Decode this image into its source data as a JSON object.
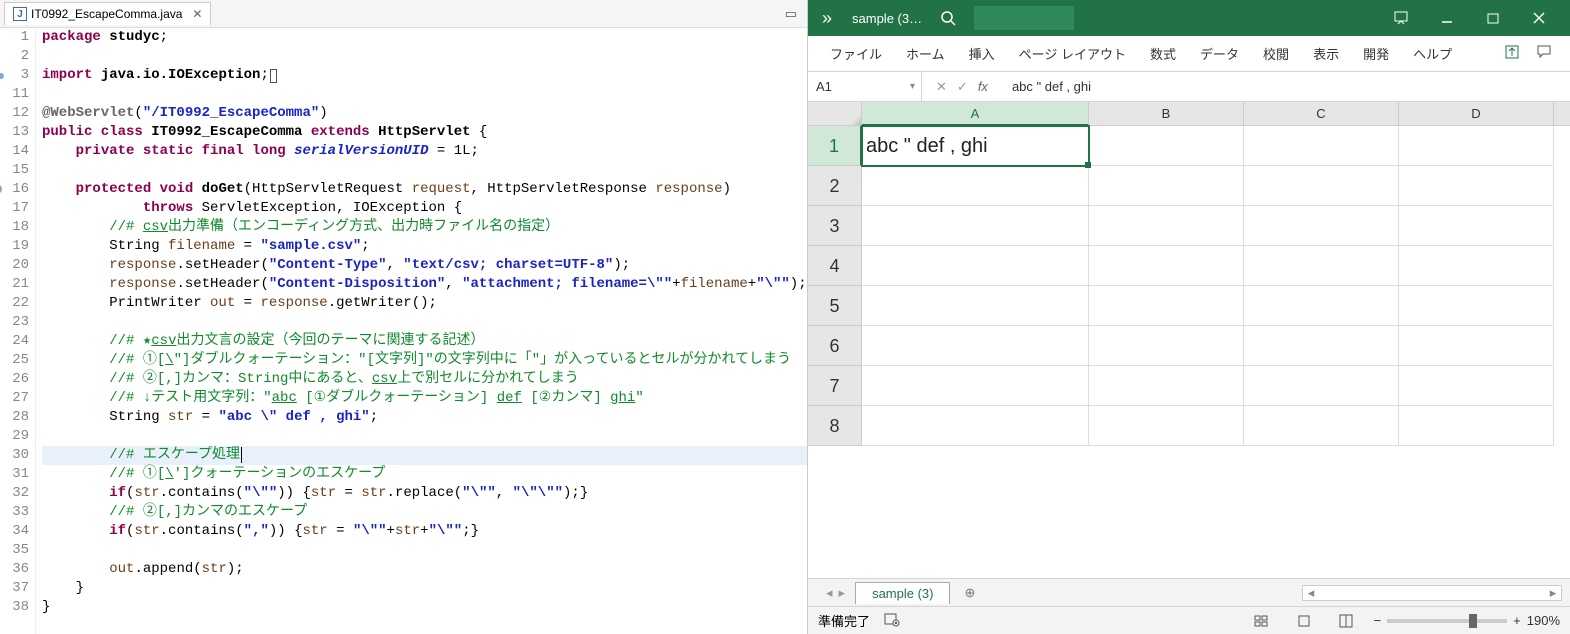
{
  "ide": {
    "tab_filename": "IT0992_EscapeComma.java",
    "tab_close": "✕",
    "lines": [
      {
        "n": "1",
        "html": "<span class='k'>package</span> <span class='t'>studyc</span>;"
      },
      {
        "n": "2",
        "html": ""
      },
      {
        "n": "3",
        "dot": true,
        "html": "<span class='k'>import</span> <span class='t'>java.io.IOException</span>;<span class='cursbox'></span>"
      },
      {
        "n": "11",
        "html": ""
      },
      {
        "n": "12",
        "html": "<span class='at'>@WebServlet</span>(<span class='s'>\"/IT0992_EscapeComma\"</span>)"
      },
      {
        "n": "13",
        "html": "<span class='k'>public class</span> <span class='t'>IT0992_EscapeComma</span> <span class='k'>extends</span> <span class='t'>HttpServlet</span> {"
      },
      {
        "n": "14",
        "html": "    <span class='k'>private static final long</span> <span class='fld'>serialVersionUID</span> = 1L;"
      },
      {
        "n": "15",
        "html": ""
      },
      {
        "n": "16",
        "tri": true,
        "dot": true,
        "html": "    <span class='k'>protected void</span> <span class='t'>doGet</span>(HttpServletRequest <span class='var'>request</span>, HttpServletResponse <span class='var'>response</span>)"
      },
      {
        "n": "17",
        "html": "            <span class='k'>throws</span> ServletException, IOException {"
      },
      {
        "n": "18",
        "html": "        <span class='c'>//# <span class='u'>csv</span>出力準備（エンコーディング方式、出力時ファイル名の指定）</span>"
      },
      {
        "n": "19",
        "html": "        String <span class='var'>filename</span> = <span class='s'>\"sample.csv\"</span>;"
      },
      {
        "n": "20",
        "html": "        <span class='var'>response</span>.setHeader(<span class='s'>\"Content-Type\"</span>, <span class='s'>\"text/csv; charset=UTF-8\"</span>);"
      },
      {
        "n": "21",
        "html": "        <span class='var'>response</span>.setHeader(<span class='s'>\"Content-Disposition\"</span>, <span class='s'>\"attachment; filename=\\\"\"</span>+<span class='var'>filename</span>+<span class='s'>\"\\\"\"</span>);"
      },
      {
        "n": "22",
        "html": "        PrintWriter <span class='var'>out</span> = <span class='var'>response</span>.getWriter();"
      },
      {
        "n": "23",
        "html": ""
      },
      {
        "n": "24",
        "html": "        <span class='c'>//# ★<span class='u'>csv</span>出力文言の設定（今回のテーマに関連する記述）</span>"
      },
      {
        "n": "25",
        "html": "        <span class='c'>//# ①[<span class='u'>\\</span>\"]ダブルクォーテーション：\"[文字列]\"の文字列中に「\"」が入っているとセルが分かれてしまう</span>"
      },
      {
        "n": "26",
        "html": "        <span class='c'>//# ②[,]カンマ：String中にあると、<span class='u'>csv</span>上で別セルに分かれてしまう</span>"
      },
      {
        "n": "27",
        "html": "        <span class='c'>//# ↓テスト用文字列：\"<span class='u'>abc</span> [①ダブルクォーテーション] <span class='u'>def</span> [②カンマ] <span class='u'>ghi</span>\"</span>"
      },
      {
        "n": "28",
        "html": "        String <span class='var'>str</span> = <span class='s'>\"abc \\\" def , ghi\"</span>;"
      },
      {
        "n": "29",
        "html": ""
      },
      {
        "n": "30",
        "hl": true,
        "html": "        <span class='c'>//# エスケープ処理</span>|"
      },
      {
        "n": "31",
        "html": "        <span class='c'>//# ①[<span class='u'>\\</span>']クォーテーションのエスケープ</span>"
      },
      {
        "n": "32",
        "html": "        <span class='k'>if</span>(<span class='var'>str</span>.contains(<span class='s'>\"\\\"\"</span>)) {<span class='var'>str</span> = <span class='var'>str</span>.replace(<span class='s'>\"\\\"\"</span>, <span class='s'>\"\\\"\\\"\"</span>);}"
      },
      {
        "n": "33",
        "html": "        <span class='c'>//# ②[,]カンマのエスケープ</span>"
      },
      {
        "n": "34",
        "html": "        <span class='k'>if</span>(<span class='var'>str</span>.contains(<span class='s'>\",\"</span>)) {<span class='var'>str</span> = <span class='s'>\"\\\"\"</span>+<span class='var'>str</span>+<span class='s'>\"\\\"\"</span>;}"
      },
      {
        "n": "35",
        "html": ""
      },
      {
        "n": "36",
        "html": "        <span class='var'>out</span>.append(<span class='var'>str</span>);"
      },
      {
        "n": "37",
        "html": "    }"
      },
      {
        "n": "38",
        "html": "}"
      }
    ]
  },
  "excel": {
    "title": "sample (3…",
    "ribbon_tabs": [
      "ファイル",
      "ホーム",
      "挿入",
      "ページ レイアウト",
      "数式",
      "データ",
      "校閲",
      "表示",
      "開発",
      "ヘルプ"
    ],
    "namebox": "A1",
    "fx_label": "fx",
    "formula": "abc \" def , ghi",
    "columns": [
      "A",
      "B",
      "C",
      "D"
    ],
    "rows": [
      "1",
      "2",
      "3",
      "4",
      "5",
      "6",
      "7",
      "8"
    ],
    "cell_A1": "abc \" def , ghi",
    "sheet_tab": "sample (3)",
    "add_sheet": "⊕",
    "status_ready": "準備完了",
    "zoom": "190%"
  }
}
